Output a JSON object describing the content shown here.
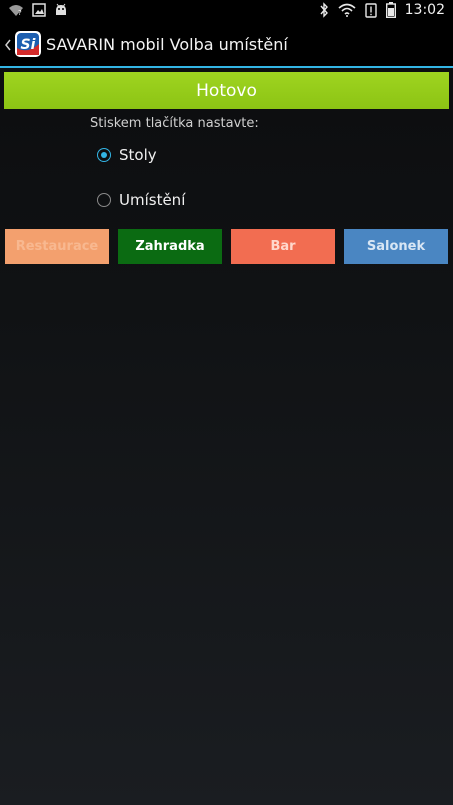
{
  "status_bar": {
    "time": "13:02",
    "left_icons": [
      "wifi-question-icon",
      "image-icon",
      "android-icon"
    ],
    "right_icons": [
      "bluetooth-icon",
      "wifi-icon",
      "alert-icon",
      "battery-icon"
    ]
  },
  "action_bar": {
    "title": "SAVARIN mobil Volba umístění",
    "logo_text": "Si"
  },
  "done_button": {
    "label": "Hotovo",
    "color": "#8cc414"
  },
  "instruction": "Stiskem tlačítka nastavte:",
  "radios": [
    {
      "label": "Stoly",
      "checked": true
    },
    {
      "label": "Umístění",
      "checked": false
    }
  ],
  "locations": [
    {
      "label": "Restaurace",
      "bg": "#f3a06e",
      "fg": "#f8b890"
    },
    {
      "label": "Zahradka",
      "bg": "#0b6b12",
      "fg": "#ffffff"
    },
    {
      "label": "Bar",
      "bg": "#f26d51",
      "fg": "#ffd8cc"
    },
    {
      "label": "Salonek",
      "bg": "#4a86c2",
      "fg": "#d8e6f4"
    }
  ],
  "colors": {
    "accent": "#33b5e5"
  }
}
